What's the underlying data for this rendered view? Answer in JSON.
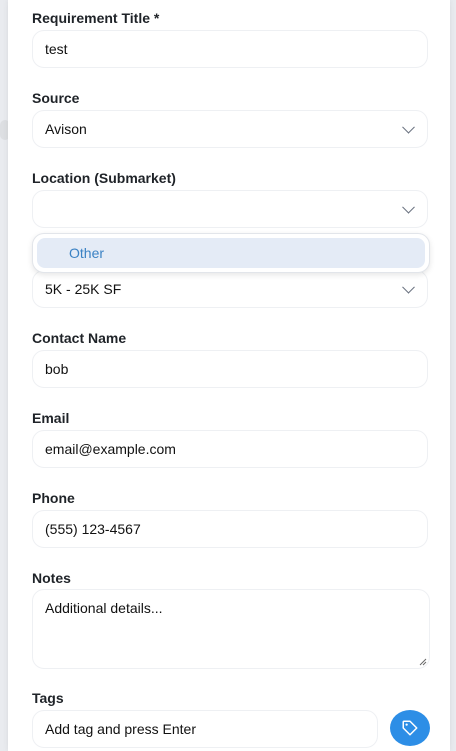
{
  "form": {
    "requirement_title_label": "Requirement Title *",
    "requirement_title_value": "test",
    "source_label": "Source",
    "source_value": "Avison",
    "location_label": "Location (Submarket)",
    "location_value": "",
    "location_dropdown_options": [
      "Other"
    ],
    "size_value": "5K - 25K SF",
    "contact_name_label": "Contact Name",
    "contact_name_value": "bob",
    "email_label": "Email",
    "email_value": "email@example.com",
    "phone_label": "Phone",
    "phone_value": "(555) 123-4567",
    "notes_label": "Notes",
    "notes_value": "Additional details...",
    "tags_label": "Tags",
    "tags_placeholder": "Add tag and press Enter"
  },
  "icons": {
    "chevron": "chevron-down-icon",
    "tag_button": "tag-icon"
  },
  "colors": {
    "accent": "#2d8ee6",
    "dropdown_option_bg": "#e4ebf6",
    "dropdown_option_text": "#3b82c4"
  }
}
